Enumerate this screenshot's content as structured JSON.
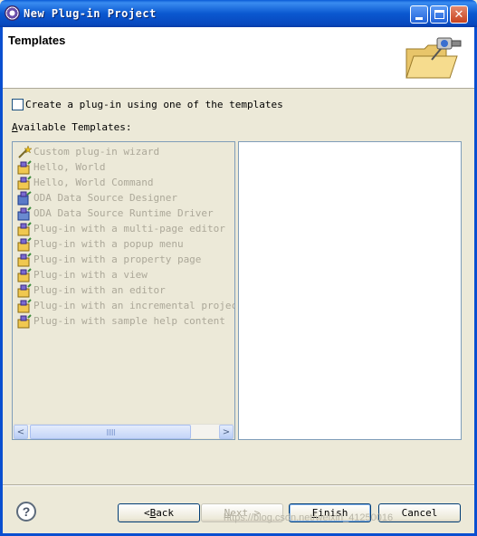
{
  "window": {
    "title": "New Plug-in Project",
    "controls": {
      "minimize": "minimize",
      "maximize": "maximize",
      "close": "✕"
    }
  },
  "banner": {
    "title": "Templates",
    "image": "plugin-folder-icon"
  },
  "checkbox": {
    "label": "Create a plug-in using one of the templates",
    "checked": false
  },
  "available": {
    "label_mnemonic": "A",
    "label_rest": "vailable Templates:"
  },
  "templates": [
    {
      "label": "Custom plug-in wizard",
      "icon": "wizard-wand-icon"
    },
    {
      "label": "Hello, World",
      "icon": "plugin-template-icon"
    },
    {
      "label": "Hello, World Command",
      "icon": "plugin-template-icon"
    },
    {
      "label": "ODA Data Source Designer",
      "icon": "oda-designer-icon"
    },
    {
      "label": "ODA Data Source Runtime Driver",
      "icon": "oda-runtime-icon"
    },
    {
      "label": "Plug-in with a multi-page editor",
      "icon": "plugin-template-icon"
    },
    {
      "label": "Plug-in with a popup menu",
      "icon": "plugin-template-icon"
    },
    {
      "label": "Plug-in with a property page",
      "icon": "plugin-template-icon"
    },
    {
      "label": "Plug-in with a view",
      "icon": "plugin-template-icon"
    },
    {
      "label": "Plug-in with an editor",
      "icon": "plugin-template-icon"
    },
    {
      "label": "Plug-in with an incremental project b",
      "icon": "plugin-template-icon"
    },
    {
      "label": "Plug-in with sample help content",
      "icon": "plugin-template-icon"
    }
  ],
  "scrollbar": {
    "left": "<",
    "right": ">"
  },
  "buttons": {
    "help": "?",
    "back_arrow": "< ",
    "back_mnemonic": "B",
    "back_rest": "ack",
    "next_mnemonic": "N",
    "next_rest": "ext >",
    "finish_mnemonic": "F",
    "finish_rest": "inish",
    "cancel": "Cancel"
  },
  "watermark": "https://blog.csdn.net/weixin_41250016"
}
